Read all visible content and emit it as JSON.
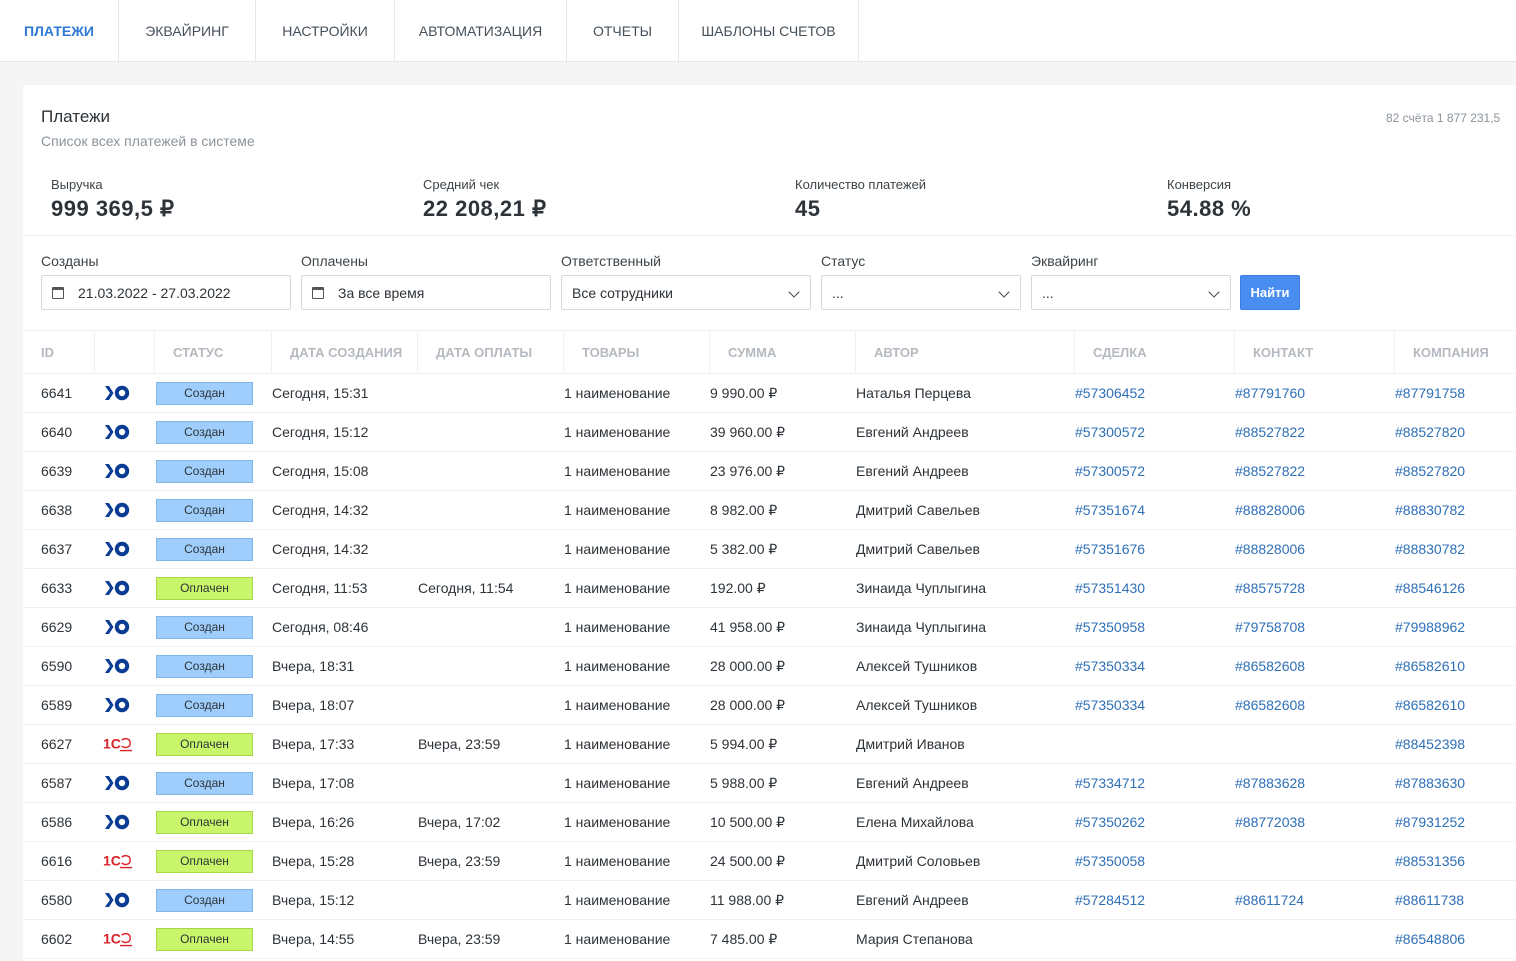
{
  "tabs": [
    {
      "label": "ПЛАТЕЖИ",
      "active": true
    },
    {
      "label": "ЭКВАЙРИНГ",
      "active": false
    },
    {
      "label": "НАСТРОЙКИ",
      "active": false
    },
    {
      "label": "АВТОМАТИЗАЦИЯ",
      "active": false
    },
    {
      "label": "ОТЧЕТЫ",
      "active": false
    },
    {
      "label": "ШАБЛОНЫ СЧЕТОВ",
      "active": false
    }
  ],
  "panel": {
    "title": "Платежи",
    "subtitle": "Список всех платежей в системе",
    "count": "82 счёта 1 877 231,5"
  },
  "stats": [
    {
      "label": "Выручка",
      "value": "999 369,5 ₽",
      "active": true
    },
    {
      "label": "Средний чек",
      "value": "22 208,21 ₽",
      "active": false
    },
    {
      "label": "Количество платежей",
      "value": "45",
      "active": false
    },
    {
      "label": "Конверсия",
      "value": "54.88 %",
      "active": false
    }
  ],
  "filters": {
    "created": {
      "label": "Созданы",
      "value": "21.03.2022 - 27.03.2022",
      "icon": "calendar-icon"
    },
    "paid": {
      "label": "Оплачены",
      "value": "За все время",
      "icon": "calendar-icon"
    },
    "responsible": {
      "label": "Ответственный",
      "value": "Все сотрудники"
    },
    "status": {
      "label": "Статус",
      "value": "..."
    },
    "acquiring": {
      "label": "Эквайринг",
      "value": "..."
    },
    "find_label": "Найти"
  },
  "table": {
    "headers": [
      "ID",
      "",
      "СТАТУС",
      "ДАТА СОЗДАНИЯ",
      "ДАТА ОПЛАТЫ",
      "ТОВАРЫ",
      "СУММА",
      "АВТОР",
      "СДЕЛКА",
      "КОНТАКТ",
      "КОМПАНИЯ"
    ],
    "rows": [
      {
        "id": "6641",
        "source": "yookassa",
        "status": "Создан",
        "created": "Сегодня, 15:31",
        "paid": "",
        "goods": "1 наименование",
        "sum": "9 990.00 ₽",
        "author": "Наталья Перцева",
        "deal": "#57306452",
        "contact": "#87791760",
        "company": "#87791758"
      },
      {
        "id": "6640",
        "source": "yookassa",
        "status": "Создан",
        "created": "Сегодня, 15:12",
        "paid": "",
        "goods": "1 наименование",
        "sum": "39 960.00 ₽",
        "author": "Евгений Андреев",
        "deal": "#57300572",
        "contact": "#88527822",
        "company": "#88527820"
      },
      {
        "id": "6639",
        "source": "yookassa",
        "status": "Создан",
        "created": "Сегодня, 15:08",
        "paid": "",
        "goods": "1 наименование",
        "sum": "23 976.00 ₽",
        "author": "Евгений Андреев",
        "deal": "#57300572",
        "contact": "#88527822",
        "company": "#88527820"
      },
      {
        "id": "6638",
        "source": "yookassa",
        "status": "Создан",
        "created": "Сегодня, 14:32",
        "paid": "",
        "goods": "1 наименование",
        "sum": "8 982.00 ₽",
        "author": "Дмитрий Савельев",
        "deal": "#57351674",
        "contact": "#88828006",
        "company": "#88830782"
      },
      {
        "id": "6637",
        "source": "yookassa",
        "status": "Создан",
        "created": "Сегодня, 14:32",
        "paid": "",
        "goods": "1 наименование",
        "sum": "5 382.00 ₽",
        "author": "Дмитрий Савельев",
        "deal": "#57351676",
        "contact": "#88828006",
        "company": "#88830782"
      },
      {
        "id": "6633",
        "source": "yookassa",
        "status": "Оплачен",
        "created": "Сегодня, 11:53",
        "paid": "Сегодня, 11:54",
        "goods": "1 наименование",
        "sum": "192.00 ₽",
        "author": "Зинаида Чуплыгина",
        "deal": "#57351430",
        "contact": "#88575728",
        "company": "#88546126"
      },
      {
        "id": "6629",
        "source": "yookassa",
        "status": "Создан",
        "created": "Сегодня, 08:46",
        "paid": "",
        "goods": "1 наименование",
        "sum": "41 958.00 ₽",
        "author": "Зинаида Чуплыгина",
        "deal": "#57350958",
        "contact": "#79758708",
        "company": "#79988962"
      },
      {
        "id": "6590",
        "source": "yookassa",
        "status": "Создан",
        "created": "Вчера, 18:31",
        "paid": "",
        "goods": "1 наименование",
        "sum": "28 000.00 ₽",
        "author": "Алексей Тушников",
        "deal": "#57350334",
        "contact": "#86582608",
        "company": "#86582610"
      },
      {
        "id": "6589",
        "source": "yookassa",
        "status": "Создан",
        "created": "Вчера, 18:07",
        "paid": "",
        "goods": "1 наименование",
        "sum": "28 000.00 ₽",
        "author": "Алексей Тушников",
        "deal": "#57350334",
        "contact": "#86582608",
        "company": "#86582610"
      },
      {
        "id": "6627",
        "source": "1c",
        "status": "Оплачен",
        "created": "Вчера, 17:33",
        "paid": "Вчера, 23:59",
        "goods": "1 наименование",
        "sum": "5 994.00 ₽",
        "author": "Дмитрий Иванов",
        "deal": "",
        "contact": "",
        "company": "#88452398"
      },
      {
        "id": "6587",
        "source": "yookassa",
        "status": "Создан",
        "created": "Вчера, 17:08",
        "paid": "",
        "goods": "1 наименование",
        "sum": "5 988.00 ₽",
        "author": "Евгений Андреев",
        "deal": "#57334712",
        "contact": "#87883628",
        "company": "#87883630"
      },
      {
        "id": "6586",
        "source": "yookassa",
        "status": "Оплачен",
        "created": "Вчера, 16:26",
        "paid": "Вчера, 17:02",
        "goods": "1 наименование",
        "sum": "10 500.00 ₽",
        "author": "Елена Михайлова",
        "deal": "#57350262",
        "contact": "#88772038",
        "company": "#87931252"
      },
      {
        "id": "6616",
        "source": "1c",
        "status": "Оплачен",
        "created": "Вчера, 15:28",
        "paid": "Вчера, 23:59",
        "goods": "1 наименование",
        "sum": "24 500.00 ₽",
        "author": "Дмитрий Соловьев",
        "deal": "#57350058",
        "contact": "",
        "company": "#88531356"
      },
      {
        "id": "6580",
        "source": "yookassa",
        "status": "Создан",
        "created": "Вчера, 15:12",
        "paid": "",
        "goods": "1 наименование",
        "sum": "11 988.00 ₽",
        "author": "Евгений Андреев",
        "deal": "#57284512",
        "contact": "#88611724",
        "company": "#88611738"
      },
      {
        "id": "6602",
        "source": "1c",
        "status": "Оплачен",
        "created": "Вчера, 14:55",
        "paid": "Вчера, 23:59",
        "goods": "1 наименование",
        "sum": "7 485.00 ₽",
        "author": "Мария Степанова",
        "deal": "",
        "contact": "",
        "company": "#86548806"
      }
    ]
  },
  "colors": {
    "accent": "#2e7ad6",
    "link": "#2e6fb8",
    "created_badge": "#9fcefc",
    "paid_badge": "#c8f56a",
    "button": "#4a8df0",
    "yookassa": "#0a3c94",
    "onec": "#d9242b"
  }
}
